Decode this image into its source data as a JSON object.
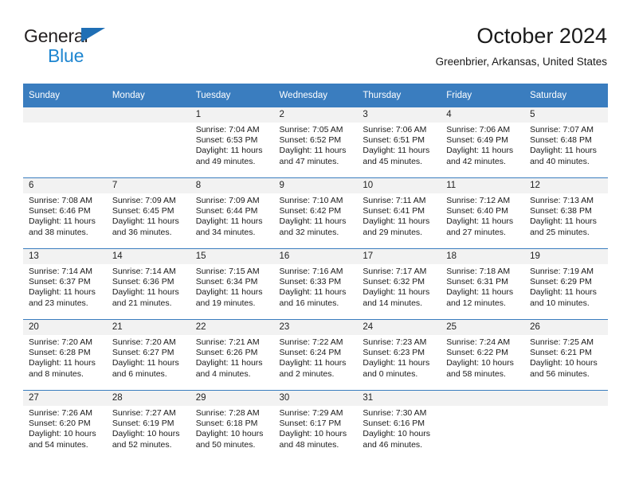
{
  "brand": {
    "line1": "General",
    "line2": "Blue",
    "triangle_color": "#1f6fb5",
    "blue_text_color": "#1f86d0"
  },
  "header": {
    "title": "October 2024",
    "subtitle": "Greenbrier, Arkansas, United States",
    "accent_color": "#3a7dbf"
  },
  "calendar": {
    "weekdays": [
      "Sunday",
      "Monday",
      "Tuesday",
      "Wednesday",
      "Thursday",
      "Friday",
      "Saturday"
    ],
    "weeks": [
      [
        {
          "day": "",
          "lines": []
        },
        {
          "day": "",
          "lines": []
        },
        {
          "day": "1",
          "lines": [
            "Sunrise: 7:04 AM",
            "Sunset: 6:53 PM",
            "Daylight: 11 hours",
            "and 49 minutes."
          ]
        },
        {
          "day": "2",
          "lines": [
            "Sunrise: 7:05 AM",
            "Sunset: 6:52 PM",
            "Daylight: 11 hours",
            "and 47 minutes."
          ]
        },
        {
          "day": "3",
          "lines": [
            "Sunrise: 7:06 AM",
            "Sunset: 6:51 PM",
            "Daylight: 11 hours",
            "and 45 minutes."
          ]
        },
        {
          "day": "4",
          "lines": [
            "Sunrise: 7:06 AM",
            "Sunset: 6:49 PM",
            "Daylight: 11 hours",
            "and 42 minutes."
          ]
        },
        {
          "day": "5",
          "lines": [
            "Sunrise: 7:07 AM",
            "Sunset: 6:48 PM",
            "Daylight: 11 hours",
            "and 40 minutes."
          ]
        }
      ],
      [
        {
          "day": "6",
          "lines": [
            "Sunrise: 7:08 AM",
            "Sunset: 6:46 PM",
            "Daylight: 11 hours",
            "and 38 minutes."
          ]
        },
        {
          "day": "7",
          "lines": [
            "Sunrise: 7:09 AM",
            "Sunset: 6:45 PM",
            "Daylight: 11 hours",
            "and 36 minutes."
          ]
        },
        {
          "day": "8",
          "lines": [
            "Sunrise: 7:09 AM",
            "Sunset: 6:44 PM",
            "Daylight: 11 hours",
            "and 34 minutes."
          ]
        },
        {
          "day": "9",
          "lines": [
            "Sunrise: 7:10 AM",
            "Sunset: 6:42 PM",
            "Daylight: 11 hours",
            "and 32 minutes."
          ]
        },
        {
          "day": "10",
          "lines": [
            "Sunrise: 7:11 AM",
            "Sunset: 6:41 PM",
            "Daylight: 11 hours",
            "and 29 minutes."
          ]
        },
        {
          "day": "11",
          "lines": [
            "Sunrise: 7:12 AM",
            "Sunset: 6:40 PM",
            "Daylight: 11 hours",
            "and 27 minutes."
          ]
        },
        {
          "day": "12",
          "lines": [
            "Sunrise: 7:13 AM",
            "Sunset: 6:38 PM",
            "Daylight: 11 hours",
            "and 25 minutes."
          ]
        }
      ],
      [
        {
          "day": "13",
          "lines": [
            "Sunrise: 7:14 AM",
            "Sunset: 6:37 PM",
            "Daylight: 11 hours",
            "and 23 minutes."
          ]
        },
        {
          "day": "14",
          "lines": [
            "Sunrise: 7:14 AM",
            "Sunset: 6:36 PM",
            "Daylight: 11 hours",
            "and 21 minutes."
          ]
        },
        {
          "day": "15",
          "lines": [
            "Sunrise: 7:15 AM",
            "Sunset: 6:34 PM",
            "Daylight: 11 hours",
            "and 19 minutes."
          ]
        },
        {
          "day": "16",
          "lines": [
            "Sunrise: 7:16 AM",
            "Sunset: 6:33 PM",
            "Daylight: 11 hours",
            "and 16 minutes."
          ]
        },
        {
          "day": "17",
          "lines": [
            "Sunrise: 7:17 AM",
            "Sunset: 6:32 PM",
            "Daylight: 11 hours",
            "and 14 minutes."
          ]
        },
        {
          "day": "18",
          "lines": [
            "Sunrise: 7:18 AM",
            "Sunset: 6:31 PM",
            "Daylight: 11 hours",
            "and 12 minutes."
          ]
        },
        {
          "day": "19",
          "lines": [
            "Sunrise: 7:19 AM",
            "Sunset: 6:29 PM",
            "Daylight: 11 hours",
            "and 10 minutes."
          ]
        }
      ],
      [
        {
          "day": "20",
          "lines": [
            "Sunrise: 7:20 AM",
            "Sunset: 6:28 PM",
            "Daylight: 11 hours",
            "and 8 minutes."
          ]
        },
        {
          "day": "21",
          "lines": [
            "Sunrise: 7:20 AM",
            "Sunset: 6:27 PM",
            "Daylight: 11 hours",
            "and 6 minutes."
          ]
        },
        {
          "day": "22",
          "lines": [
            "Sunrise: 7:21 AM",
            "Sunset: 6:26 PM",
            "Daylight: 11 hours",
            "and 4 minutes."
          ]
        },
        {
          "day": "23",
          "lines": [
            "Sunrise: 7:22 AM",
            "Sunset: 6:24 PM",
            "Daylight: 11 hours",
            "and 2 minutes."
          ]
        },
        {
          "day": "24",
          "lines": [
            "Sunrise: 7:23 AM",
            "Sunset: 6:23 PM",
            "Daylight: 11 hours",
            "and 0 minutes."
          ]
        },
        {
          "day": "25",
          "lines": [
            "Sunrise: 7:24 AM",
            "Sunset: 6:22 PM",
            "Daylight: 10 hours",
            "and 58 minutes."
          ]
        },
        {
          "day": "26",
          "lines": [
            "Sunrise: 7:25 AM",
            "Sunset: 6:21 PM",
            "Daylight: 10 hours",
            "and 56 minutes."
          ]
        }
      ],
      [
        {
          "day": "27",
          "lines": [
            "Sunrise: 7:26 AM",
            "Sunset: 6:20 PM",
            "Daylight: 10 hours",
            "and 54 minutes."
          ]
        },
        {
          "day": "28",
          "lines": [
            "Sunrise: 7:27 AM",
            "Sunset: 6:19 PM",
            "Daylight: 10 hours",
            "and 52 minutes."
          ]
        },
        {
          "day": "29",
          "lines": [
            "Sunrise: 7:28 AM",
            "Sunset: 6:18 PM",
            "Daylight: 10 hours",
            "and 50 minutes."
          ]
        },
        {
          "day": "30",
          "lines": [
            "Sunrise: 7:29 AM",
            "Sunset: 6:17 PM",
            "Daylight: 10 hours",
            "and 48 minutes."
          ]
        },
        {
          "day": "31",
          "lines": [
            "Sunrise: 7:30 AM",
            "Sunset: 6:16 PM",
            "Daylight: 10 hours",
            "and 46 minutes."
          ]
        },
        {
          "day": "",
          "lines": []
        },
        {
          "day": "",
          "lines": []
        }
      ]
    ]
  }
}
